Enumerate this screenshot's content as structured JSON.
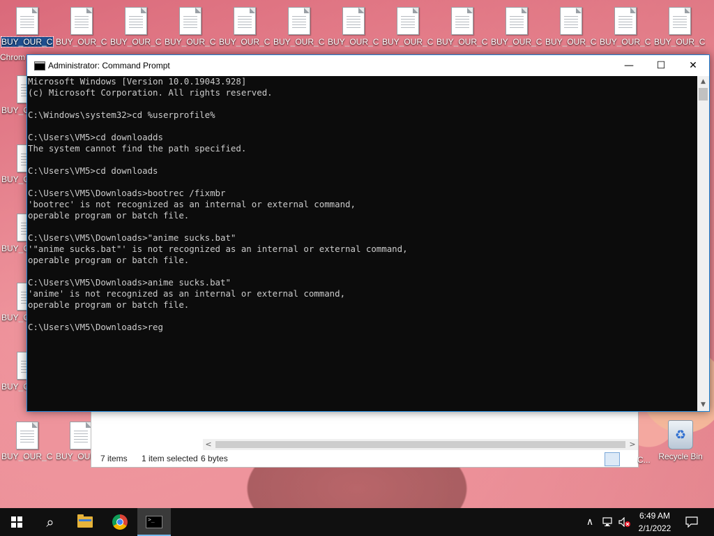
{
  "desktop": {
    "top_row_icons": [
      {
        "label": "BUY_OUR_C..."
      },
      {
        "label": "BUY_OUR_C..."
      },
      {
        "label": "BUY_OUR_C..."
      },
      {
        "label": "BUY_OUR_C..."
      },
      {
        "label": "BUY_OUR_C..."
      },
      {
        "label": "BUY_OUR_C..."
      },
      {
        "label": "BUY_OUR_C..."
      },
      {
        "label": "BUY_OUR_C..."
      },
      {
        "label": "BUY_OUR_C..."
      },
      {
        "label": "BUY_OUR_C..."
      },
      {
        "label": "BUY_OUR_C..."
      },
      {
        "label": "BUY_OUR_C..."
      },
      {
        "label": "BUY_OUR_C..."
      }
    ],
    "chrome_shortcut_label": "Chrom",
    "left_column_labels": [
      "BUY_O",
      "BUY_O",
      "BUY_O",
      "BUY_O",
      "BUY_O"
    ],
    "bottom_icons": [
      {
        "label": "BUY_OUR_C..."
      },
      {
        "label": "BUY_OUR"
      }
    ],
    "partial_right_label": "C...",
    "recycle_bin_label": "Recycle Bin"
  },
  "explorer": {
    "item_count": "7 items",
    "selection": "1 item selected",
    "size": "6 bytes"
  },
  "cmd_window": {
    "title": "Administrator: Command Prompt",
    "minimize_glyph": "—",
    "maximize_glyph": "☐",
    "close_glyph": "✕",
    "lines": [
      "Microsoft Windows [Version 10.0.19043.928]",
      "(c) Microsoft Corporation. All rights reserved.",
      "",
      "C:\\Windows\\system32>cd %userprofile%",
      "",
      "C:\\Users\\VM5>cd downloadds",
      "The system cannot find the path specified.",
      "",
      "C:\\Users\\VM5>cd downloads",
      "",
      "C:\\Users\\VM5\\Downloads>bootrec /fixmbr",
      "'bootrec' is not recognized as an internal or external command,",
      "operable program or batch file.",
      "",
      "C:\\Users\\VM5\\Downloads>\"anime sucks.bat\"",
      "'\"anime sucks.bat\"' is not recognized as an internal or external command,",
      "operable program or batch file.",
      "",
      "C:\\Users\\VM5\\Downloads>anime sucks.bat\"",
      "'anime' is not recognized as an internal or external command,",
      "operable program or batch file.",
      "",
      "C:\\Users\\VM5\\Downloads>reg"
    ]
  },
  "taskbar": {
    "start_icon": "windows-logo-icon",
    "search_glyph": "⌕",
    "pinned": [
      "file-explorer-icon",
      "chrome-icon",
      "command-prompt-icon"
    ],
    "tray": {
      "chevron": "∧",
      "network_icon": "network-icon",
      "volume_icon": "volume-muted-icon",
      "time": "6:49 AM",
      "date": "2/1/2022",
      "notification_icon": "notification-icon"
    }
  },
  "colors": {
    "cmd_bg": "#0c0c0c",
    "cmd_text": "#cccccc",
    "taskbar_bg": "#101010",
    "accent": "#1883d7"
  }
}
